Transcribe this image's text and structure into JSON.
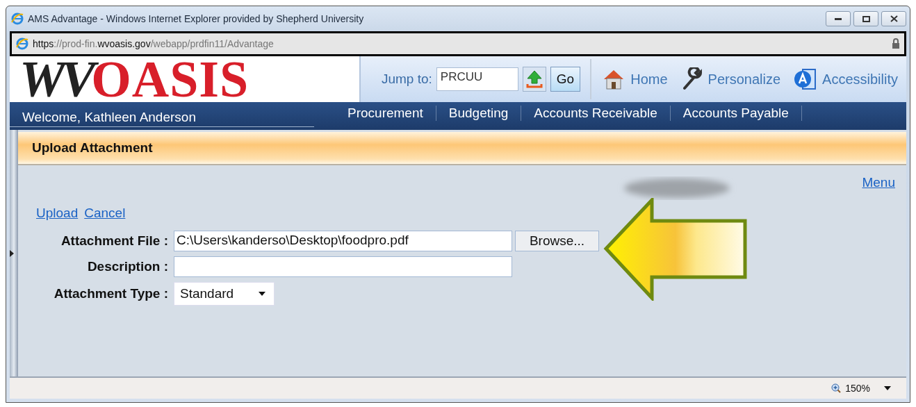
{
  "window": {
    "title": "AMS Advantage - Windows Internet Explorer provided by Shepherd University"
  },
  "address_bar": {
    "url": "**https**://prod-fin.**wvoasis.gov**/webapp/prdfin11/Advantage"
  },
  "header": {
    "logo_prefix": "WV",
    "logo_name": "OASIS",
    "jump_label": "Jump to:",
    "jump_value": "PRCUU",
    "go_button": "Go",
    "links": [
      {
        "label": "Home",
        "kind": "home"
      },
      {
        "label": "Personalize",
        "kind": "wrench"
      },
      {
        "label": "Accessibility",
        "kind": "accessibility"
      }
    ]
  },
  "nav": {
    "welcome": "Welcome, Kathleen Anderson",
    "items": [
      "Procurement",
      "Budgeting",
      "Accounts Receivable",
      "Accounts Payable"
    ]
  },
  "page": {
    "title": "Upload Attachment",
    "menu_link": "Menu",
    "actions": [
      "Upload",
      "Cancel"
    ],
    "fields": [
      {
        "label": "Attachment File :",
        "kind": "file",
        "value": "C:\\Users\\kanderso\\Desktop\\foodpro.pdf",
        "button": "Browse..."
      },
      {
        "label": "Description :",
        "kind": "text"
      },
      {
        "label": "Attachment Type :",
        "kind": "select",
        "value": "Standard"
      }
    ]
  },
  "status_bar": {
    "zoom": "150%"
  }
}
